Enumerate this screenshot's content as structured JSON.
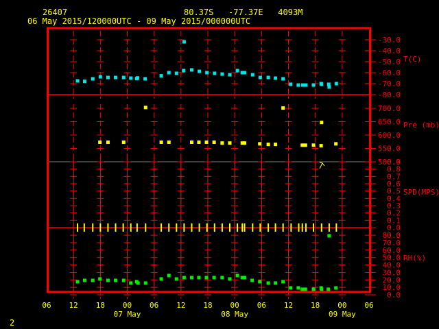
{
  "header": {
    "station": "26407",
    "location": "80.37S   -77.37E   4093M",
    "period": "06 May 2015/120000UTC - 09 May 2015/000000UTC"
  },
  "footer": {
    "page": "2"
  },
  "colors": {
    "frame": "#ff0000",
    "temperature": "#00e5e5",
    "pressure": "#ffff00",
    "wind": "#ffff00",
    "rh": "#00ee00",
    "text": "#ffff00",
    "divider": "#808080"
  },
  "chart_data": {
    "type": "scatter",
    "title": "26407 80.37S -77.37E 4093M",
    "subtitle": "06 May 2015/120000UTC - 09 May 2015/000000UTC",
    "x_units": "hours since 06 May 2015 06UTC",
    "xlim": [
      0,
      72
    ],
    "x_ticks": [
      {
        "t": 0,
        "label": "06"
      },
      {
        "t": 6,
        "label": "12"
      },
      {
        "t": 12,
        "label": "18"
      },
      {
        "t": 18,
        "label": "00"
      },
      {
        "t": 24,
        "label": "06"
      },
      {
        "t": 30,
        "label": "12"
      },
      {
        "t": 36,
        "label": "18"
      },
      {
        "t": 42,
        "label": "00"
      },
      {
        "t": 48,
        "label": "06"
      },
      {
        "t": 54,
        "label": "12"
      },
      {
        "t": 60,
        "label": "18"
      },
      {
        "t": 66,
        "label": "00"
      },
      {
        "t": 72,
        "label": "06"
      }
    ],
    "date_labels": [
      {
        "t": 18,
        "label": "07 May"
      },
      {
        "t": 42,
        "label": "08 May"
      },
      {
        "t": 66,
        "label": "09 May"
      }
    ],
    "grid": true,
    "panels": [
      {
        "name": "temperature",
        "label": "T(C)",
        "ylim": [
          -80,
          -30
        ],
        "ticks": [
          -30,
          -40,
          -50,
          -60,
          -70,
          -80
        ],
        "points": [
          [
            6.9,
            -67.5
          ],
          [
            8.5,
            -67.9
          ],
          [
            10.3,
            -65.6
          ],
          [
            12.0,
            -63.8
          ],
          [
            13.7,
            -64.4
          ],
          [
            15.4,
            -64.4
          ],
          [
            17.2,
            -64.4
          ],
          [
            18.8,
            -65.0
          ],
          [
            20.1,
            -65.4
          ],
          [
            20.3,
            -64.8
          ],
          [
            22.0,
            -65.6
          ],
          [
            25.6,
            -62.9
          ],
          [
            27.3,
            -60.0
          ],
          [
            29.0,
            -60.6
          ],
          [
            30.6,
            -58.1
          ],
          [
            30.7,
            -31.9
          ],
          [
            32.4,
            -57.5
          ],
          [
            34.1,
            -58.8
          ],
          [
            35.8,
            -60.0
          ],
          [
            37.5,
            -60.6
          ],
          [
            39.2,
            -61.3
          ],
          [
            40.9,
            -61.9
          ],
          [
            42.6,
            -58.1
          ],
          [
            43.7,
            -60.0
          ],
          [
            44.2,
            -60.0
          ],
          [
            46.0,
            -61.9
          ],
          [
            47.7,
            -64.4
          ],
          [
            49.5,
            -64.4
          ],
          [
            51.1,
            -65.0
          ],
          [
            52.8,
            -65.6
          ],
          [
            54.5,
            -70.6
          ],
          [
            56.2,
            -71.3
          ],
          [
            57.2,
            -71.3
          ],
          [
            57.9,
            -71.3
          ],
          [
            59.6,
            -71.3
          ],
          [
            61.3,
            -70.0
          ],
          [
            61.4,
            -70.6
          ],
          [
            63.0,
            -70.6
          ],
          [
            63.1,
            -73.1
          ],
          [
            64.7,
            -70.0
          ]
        ]
      },
      {
        "name": "pressure",
        "label": "Pre (mb)",
        "ylim": [
          500,
          700
        ],
        "ticks": [
          700,
          650,
          600,
          550,
          500
        ],
        "points": [
          [
            11.9,
            573
          ],
          [
            13.7,
            573
          ],
          [
            17.2,
            573
          ],
          [
            22.1,
            703
          ],
          [
            25.6,
            573
          ],
          [
            27.3,
            573
          ],
          [
            32.4,
            573
          ],
          [
            34.0,
            573
          ],
          [
            35.7,
            573
          ],
          [
            37.4,
            573
          ],
          [
            39.2,
            570
          ],
          [
            40.9,
            570
          ],
          [
            43.7,
            570
          ],
          [
            44.2,
            570
          ],
          [
            47.6,
            567
          ],
          [
            49.5,
            565
          ],
          [
            51.1,
            565
          ],
          [
            52.8,
            701
          ],
          [
            57.1,
            562
          ],
          [
            57.8,
            562
          ],
          [
            59.6,
            562
          ],
          [
            61.3,
            560
          ],
          [
            61.4,
            647
          ],
          [
            64.6,
            567
          ]
        ]
      },
      {
        "name": "wind_speed",
        "label": "SPD(MPS)",
        "ylim": [
          0,
          0.9
        ],
        "ticks": [
          0.9,
          0.8,
          0.7,
          0.6,
          0.5,
          0.4,
          0.3,
          0.2,
          0.1,
          0.0
        ],
        "points": [
          [
            6.9,
            0
          ],
          [
            8.4,
            0
          ],
          [
            10.3,
            0
          ],
          [
            12.0,
            0
          ],
          [
            13.7,
            0
          ],
          [
            15.4,
            0
          ],
          [
            17.1,
            0
          ],
          [
            18.8,
            0
          ],
          [
            20.2,
            0
          ],
          [
            22.1,
            0
          ],
          [
            25.6,
            0
          ],
          [
            27.3,
            0
          ],
          [
            29.0,
            0
          ],
          [
            30.7,
            0
          ],
          [
            32.4,
            0
          ],
          [
            34.1,
            0
          ],
          [
            35.8,
            0
          ],
          [
            37.5,
            0
          ],
          [
            39.2,
            0
          ],
          [
            40.9,
            0
          ],
          [
            42.6,
            0
          ],
          [
            43.7,
            0
          ],
          [
            44.2,
            0
          ],
          [
            46.0,
            0
          ],
          [
            47.7,
            0
          ],
          [
            49.5,
            0
          ],
          [
            51.1,
            0
          ],
          [
            52.8,
            0
          ],
          [
            54.6,
            0
          ],
          [
            56.3,
            0
          ],
          [
            57.1,
            0
          ],
          [
            57.9,
            0
          ],
          [
            59.6,
            0
          ],
          [
            61.4,
            0
          ],
          [
            63.1,
            0
          ],
          [
            64.7,
            0
          ]
        ]
      },
      {
        "name": "relative_humidity",
        "label": "RH(%)",
        "ylim": [
          0,
          80
        ],
        "ticks": [
          80,
          70,
          60,
          50,
          40,
          30,
          20,
          10,
          0
        ],
        "points": [
          [
            6.9,
            17.5
          ],
          [
            8.5,
            19.3
          ],
          [
            10.3,
            19.3
          ],
          [
            11.9,
            21.2
          ],
          [
            13.7,
            19.3
          ],
          [
            15.4,
            19.3
          ],
          [
            17.2,
            19.3
          ],
          [
            18.8,
            15.7
          ],
          [
            20.1,
            17.5
          ],
          [
            20.4,
            15.7
          ],
          [
            22.1,
            15.7
          ],
          [
            25.6,
            21.2
          ],
          [
            27.3,
            25.8
          ],
          [
            29.0,
            21.2
          ],
          [
            30.7,
            23.0
          ],
          [
            32.4,
            23.0
          ],
          [
            34.0,
            23.0
          ],
          [
            35.7,
            23.0
          ],
          [
            37.4,
            23.0
          ],
          [
            39.2,
            23.0
          ],
          [
            40.9,
            21.2
          ],
          [
            42.6,
            25.8
          ],
          [
            43.7,
            23.0
          ],
          [
            44.2,
            23.0
          ],
          [
            45.9,
            19.3
          ],
          [
            47.6,
            17.5
          ],
          [
            49.5,
            15.7
          ],
          [
            51.1,
            15.7
          ],
          [
            52.8,
            17.5
          ],
          [
            54.5,
            9.2
          ],
          [
            56.2,
            9.2
          ],
          [
            57.1,
            7.4
          ],
          [
            57.8,
            7.4
          ],
          [
            59.6,
            7.4
          ],
          [
            61.3,
            9.2
          ],
          [
            61.4,
            7.4
          ],
          [
            62.9,
            7.4
          ],
          [
            63.1,
            79.2
          ],
          [
            64.6,
            9.2
          ]
        ]
      }
    ]
  }
}
